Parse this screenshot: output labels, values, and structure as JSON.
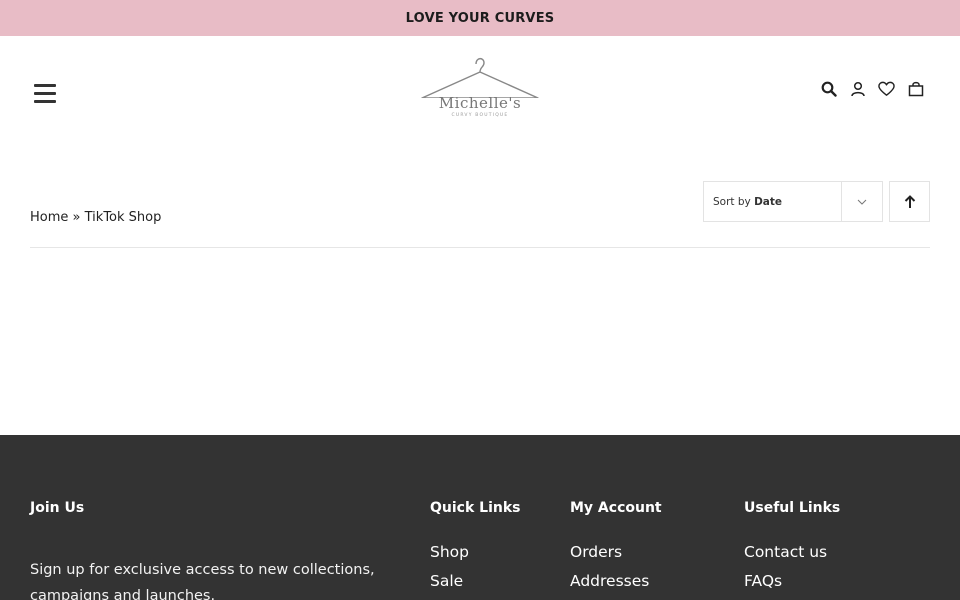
{
  "announcement": {
    "text": "LOVE YOUR CURVES"
  },
  "brand": {
    "name": "Michelle's",
    "tagline": "CURVY BOUTIQUE"
  },
  "header": {
    "icons": [
      "search-icon",
      "account-icon",
      "wishlist-heart-icon",
      "cart-bag-icon"
    ]
  },
  "breadcrumb": {
    "home": "Home",
    "separator": "»",
    "current": "TikTok Shop"
  },
  "sort": {
    "prefix": "Sort by",
    "value": "Date"
  },
  "footer": {
    "join": {
      "title": "Join Us",
      "text": "Sign up for exclusive access to new collections, campaigns and launches."
    },
    "quick_links": {
      "title": "Quick Links",
      "items": [
        "Shop",
        "Sale"
      ]
    },
    "my_account": {
      "title": "My Account",
      "items": [
        "Orders",
        "Addresses"
      ]
    },
    "useful_links": {
      "title": "Useful Links",
      "items": [
        "Contact us",
        "FAQs"
      ]
    }
  },
  "colors": {
    "announcement_bg": "#e8bcc6",
    "footer_bg": "#333333"
  }
}
